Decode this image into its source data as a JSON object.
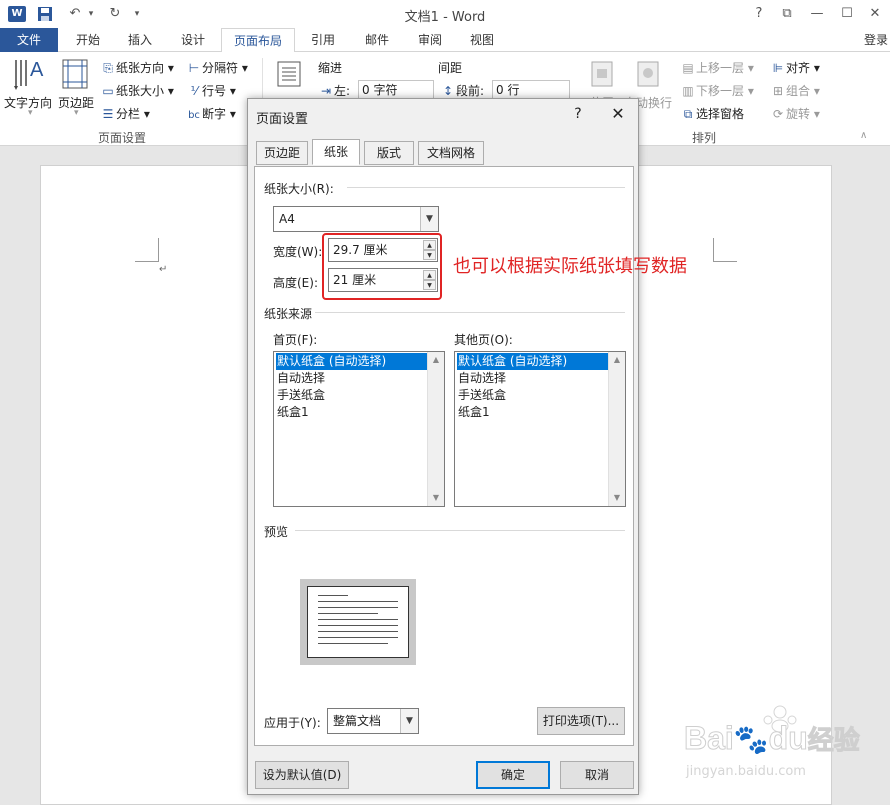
{
  "titlebar": {
    "app_logo_letter": "W",
    "title": "文档1 - Word",
    "help": "?",
    "restore": "⧉",
    "minimize": "—",
    "maximize": "☐",
    "close": "✕"
  },
  "tabs": {
    "file": "文件",
    "home": "开始",
    "insert": "插入",
    "design": "设计",
    "layout": "页面布局",
    "references": "引用",
    "mailings": "邮件",
    "review": "审阅",
    "view": "视图",
    "login": "登录"
  },
  "ribbon": {
    "text_direction": "文字方向",
    "margins": "页边距",
    "orientation": "纸张方向",
    "size": "纸张大小",
    "columns": "分栏",
    "breaks": "分隔符",
    "line_numbers": "行号",
    "hyphenation": "断字",
    "page_setup_group": "页面设置",
    "indent": "缩进",
    "spacing": "间距",
    "indent_left_label": "左:",
    "indent_left_value": "0 字符",
    "spacing_before_label": "段前:",
    "spacing_before_value": "0 行",
    "position": "位置",
    "wrap_text": "自动换行",
    "bring_forward": "上移一层",
    "send_backward": "下移一层",
    "selection_pane": "选择窗格",
    "align": "对齐",
    "group": "组合",
    "rotate": "旋转",
    "arrange_group": "排列"
  },
  "document": {
    "paragraph_mark": "↵"
  },
  "dialog": {
    "title": "页面设置",
    "help": "?",
    "close": "✕",
    "tabs": [
      "页边距",
      "纸张",
      "版式",
      "文档网格"
    ],
    "active_tab": "纸张",
    "paper_size_label": "纸张大小(R):",
    "paper_size_value": "A4",
    "width_label": "宽度(W):",
    "width_value": "29.7 厘米",
    "height_label": "高度(E):",
    "height_value": "21 厘米",
    "paper_source_label": "纸张来源",
    "first_page_label": "首页(F):",
    "other_pages_label": "其他页(O):",
    "first_page_items": [
      "默认纸盒 (自动选择)",
      "自动选择",
      "手送纸盒",
      "纸盒1"
    ],
    "other_pages_items": [
      "默认纸盒 (自动选择)",
      "自动选择",
      "手送纸盒",
      "纸盒1"
    ],
    "preview_label": "预览",
    "apply_to_label": "应用于(Y):",
    "apply_to_value": "整篇文档",
    "print_options": "打印选项(T)...",
    "set_default": "设为默认值(D)",
    "ok": "确定",
    "cancel": "取消"
  },
  "annotation": "也可以根据实际纸张填写数据",
  "watermark": {
    "brand": "Bai",
    "brand2": "du",
    "suffix": "经验",
    "url": "jingyan.baidu.com"
  },
  "colors": {
    "accent": "#2b579a",
    "selection": "#0078d7",
    "annotation": "#e02424"
  }
}
